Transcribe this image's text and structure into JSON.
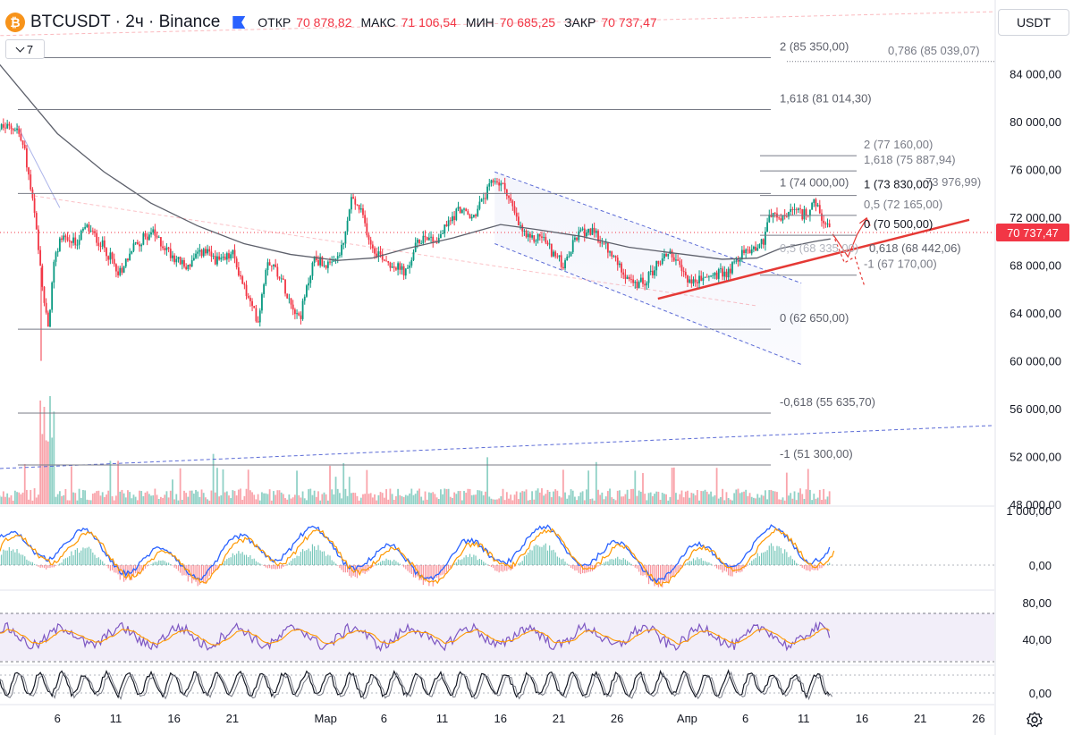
{
  "header": {
    "symbol_icon": "bitcoin-icon",
    "symbol_icon_glyph": "₿",
    "title": "BTCUSDT · 2ч · Binance",
    "open_label": "ОТКР",
    "open": "70 878,82",
    "high_label": "МАКС",
    "high": "71 106,54",
    "low_label": "МИН",
    "low": "70 685,25",
    "close_label": "ЗАКР",
    "close": "70 737,47"
  },
  "indicators_button": {
    "label": "7"
  },
  "currency_button": {
    "label": "USDT"
  },
  "colors": {
    "up": "#089981",
    "down": "#f23645",
    "accent": "#2962ff",
    "trendline": "#e53935",
    "ma": "#5d606b",
    "rsi": "#7e57c2",
    "signal": "#ff9800"
  },
  "chart_data": {
    "type": "candlestick",
    "symbol": "BTCUSDT",
    "interval": "2ч",
    "exchange": "Binance",
    "ylim": [
      47000,
      88000
    ],
    "y_ticks": [
      {
        "value": 84000,
        "label": "84 000,00"
      },
      {
        "value": 80000,
        "label": "80 000,00"
      },
      {
        "value": 76000,
        "label": "76 000,00"
      },
      {
        "value": 72000,
        "label": "72 000,00"
      },
      {
        "value": 68000,
        "label": "68 000,00"
      },
      {
        "value": 64000,
        "label": "64 000,00"
      },
      {
        "value": 60000,
        "label": "60 000,00"
      },
      {
        "value": 56000,
        "label": "56 000,00"
      },
      {
        "value": 52000,
        "label": "52 000,00"
      },
      {
        "value": 48000,
        "label": "48 000,00"
      }
    ],
    "x_ticks": [
      {
        "day": 6,
        "label": "6"
      },
      {
        "day": 11,
        "label": "11"
      },
      {
        "day": 16,
        "label": "16"
      },
      {
        "day": 21,
        "label": "21"
      },
      {
        "day": 29,
        "label": "Мар"
      },
      {
        "day": 34,
        "label": "6"
      },
      {
        "day": 39,
        "label": "11"
      },
      {
        "day": 44,
        "label": "16"
      },
      {
        "day": 49,
        "label": "21"
      },
      {
        "day": 54,
        "label": "26"
      },
      {
        "day": 60,
        "label": "Апр"
      },
      {
        "day": 65,
        "label": "6"
      },
      {
        "day": 70,
        "label": "11"
      },
      {
        "day": 75,
        "label": "16"
      },
      {
        "day": 80,
        "label": "21"
      },
      {
        "day": 85,
        "label": "26"
      }
    ],
    "last_price": {
      "value": 70737.47,
      "label": "70 737,47"
    },
    "price_path": [
      {
        "day": 2.5,
        "price": 79500
      },
      {
        "day": 3.2,
        "price": 77500
      },
      {
        "day": 4.0,
        "price": 72500
      },
      {
        "day": 4.6,
        "price": 67000
      },
      {
        "day": 5.2,
        "price": 62500
      },
      {
        "day": 5.6,
        "price": 67500
      },
      {
        "day": 6.3,
        "price": 70500
      },
      {
        "day": 7.5,
        "price": 69800
      },
      {
        "day": 8.5,
        "price": 71200
      },
      {
        "day": 10.0,
        "price": 69500
      },
      {
        "day": 11.3,
        "price": 67400
      },
      {
        "day": 12.5,
        "price": 69500
      },
      {
        "day": 14.0,
        "price": 70800
      },
      {
        "day": 15.5,
        "price": 69200
      },
      {
        "day": 17.0,
        "price": 67800
      },
      {
        "day": 18.5,
        "price": 69200
      },
      {
        "day": 20.0,
        "price": 68200
      },
      {
        "day": 21.0,
        "price": 69000
      },
      {
        "day": 22.5,
        "price": 64800
      },
      {
        "day": 23.2,
        "price": 63400
      },
      {
        "day": 24.0,
        "price": 68600
      },
      {
        "day": 25.0,
        "price": 67300
      },
      {
        "day": 26.0,
        "price": 65000
      },
      {
        "day": 26.8,
        "price": 63600
      },
      {
        "day": 28.0,
        "price": 68600
      },
      {
        "day": 29.5,
        "price": 67800
      },
      {
        "day": 30.5,
        "price": 69500
      },
      {
        "day": 31.2,
        "price": 73600
      },
      {
        "day": 32.0,
        "price": 72500
      },
      {
        "day": 33.0,
        "price": 69500
      },
      {
        "day": 34.5,
        "price": 68200
      },
      {
        "day": 36.0,
        "price": 67300
      },
      {
        "day": 36.6,
        "price": 69400
      },
      {
        "day": 37.5,
        "price": 70600
      },
      {
        "day": 38.5,
        "price": 70000
      },
      {
        "day": 39.5,
        "price": 71500
      },
      {
        "day": 40.5,
        "price": 72800
      },
      {
        "day": 41.5,
        "price": 71800
      },
      {
        "day": 42.5,
        "price": 73500
      },
      {
        "day": 43.5,
        "price": 75200
      },
      {
        "day": 44.5,
        "price": 74300
      },
      {
        "day": 45.5,
        "price": 71400
      },
      {
        "day": 46.5,
        "price": 70000
      },
      {
        "day": 47.5,
        "price": 70500
      },
      {
        "day": 48.5,
        "price": 69000
      },
      {
        "day": 49.5,
        "price": 67900
      },
      {
        "day": 50.5,
        "price": 70400
      },
      {
        "day": 51.5,
        "price": 71000
      },
      {
        "day": 52.5,
        "price": 70200
      },
      {
        "day": 53.5,
        "price": 68800
      },
      {
        "day": 54.5,
        "price": 67600
      },
      {
        "day": 55.5,
        "price": 66200
      },
      {
        "day": 56.5,
        "price": 66800
      },
      {
        "day": 57.5,
        "price": 68200
      },
      {
        "day": 58.5,
        "price": 69200
      },
      {
        "day": 59.5,
        "price": 67500
      },
      {
        "day": 60.5,
        "price": 66500
      },
      {
        "day": 61.5,
        "price": 67000
      },
      {
        "day": 62.5,
        "price": 67200
      },
      {
        "day": 63.5,
        "price": 67400
      },
      {
        "day": 64.5,
        "price": 68800
      },
      {
        "day": 65.5,
        "price": 69400
      },
      {
        "day": 66.5,
        "price": 69900
      },
      {
        "day": 67.0,
        "price": 72300
      },
      {
        "day": 68.0,
        "price": 71800
      },
      {
        "day": 69.0,
        "price": 72500
      },
      {
        "day": 70.0,
        "price": 72200
      },
      {
        "day": 71.0,
        "price": 73200
      },
      {
        "day": 71.6,
        "price": 71700
      },
      {
        "day": 72.3,
        "price": 70737
      }
    ],
    "moving_average": [
      {
        "day": 0.0,
        "price": 86000
      },
      {
        "day": 3.0,
        "price": 82500
      },
      {
        "day": 6.0,
        "price": 79000
      },
      {
        "day": 10.0,
        "price": 75800
      },
      {
        "day": 14.0,
        "price": 73200
      },
      {
        "day": 18.0,
        "price": 71300
      },
      {
        "day": 22.0,
        "price": 69800
      },
      {
        "day": 26.0,
        "price": 68900
      },
      {
        "day": 30.0,
        "price": 68400
      },
      {
        "day": 33.0,
        "price": 68600
      },
      {
        "day": 36.0,
        "price": 69400
      },
      {
        "day": 40.0,
        "price": 70300
      },
      {
        "day": 44.0,
        "price": 71400
      },
      {
        "day": 47.0,
        "price": 71000
      },
      {
        "day": 51.0,
        "price": 70400
      },
      {
        "day": 55.0,
        "price": 69500
      },
      {
        "day": 59.0,
        "price": 69000
      },
      {
        "day": 63.0,
        "price": 68500
      },
      {
        "day": 66.0,
        "price": 68600
      },
      {
        "day": 68.0,
        "price": 69400
      },
      {
        "day": 71.0,
        "price": 70000
      },
      {
        "day": 72.3,
        "price": 70200
      }
    ],
    "fib_levels_left": [
      {
        "price": 85350,
        "label": "2 (85 350,00)"
      },
      {
        "price": 81014.3,
        "label": "1,618 (81 014,30)"
      },
      {
        "price": 74000,
        "label": "1 (74 000,00)"
      },
      {
        "price": 62650,
        "label": "0 (62 650,00)"
      },
      {
        "price": 55635.7,
        "label": "-0,618 (55 635,70)"
      },
      {
        "price": 51300,
        "label": "-1 (51 300,00)"
      }
    ],
    "fib_levels_right": [
      {
        "price": 77160,
        "label": "2 (77 160,00)"
      },
      {
        "price": 75887.94,
        "label": "1,618 (75 887,94)"
      },
      {
        "price": 73830,
        "label": "1 (73 830,00)"
      },
      {
        "price": 72165,
        "label": "0,5 (72 165,00)"
      },
      {
        "price": 70500,
        "label": "0 (70 500,00)"
      },
      {
        "price": 67170,
        "label": "-1 (67 170,00)"
      }
    ],
    "extra_labels": [
      {
        "price": 85039.07,
        "label": "0,786 (85 039,07)"
      },
      {
        "price": 73976.99,
        "label": "73 976,99)"
      },
      {
        "price": 68442.06,
        "label": "0,618 (68 442,06)"
      },
      {
        "price": 68335,
        "label": "0,5 (68 335,00)"
      }
    ],
    "macd_panel": {
      "ticks": [
        {
          "value": 1000,
          "label": "1 000,00"
        },
        {
          "value": 0,
          "label": "0,00"
        }
      ]
    },
    "rsi_panel": {
      "ticks": [
        {
          "value": 80,
          "label": "80,00"
        },
        {
          "value": 40,
          "label": "40,00"
        }
      ]
    },
    "stoch_panel": {
      "ticks": [
        {
          "value": 0,
          "label": "0,00"
        }
      ]
    }
  }
}
